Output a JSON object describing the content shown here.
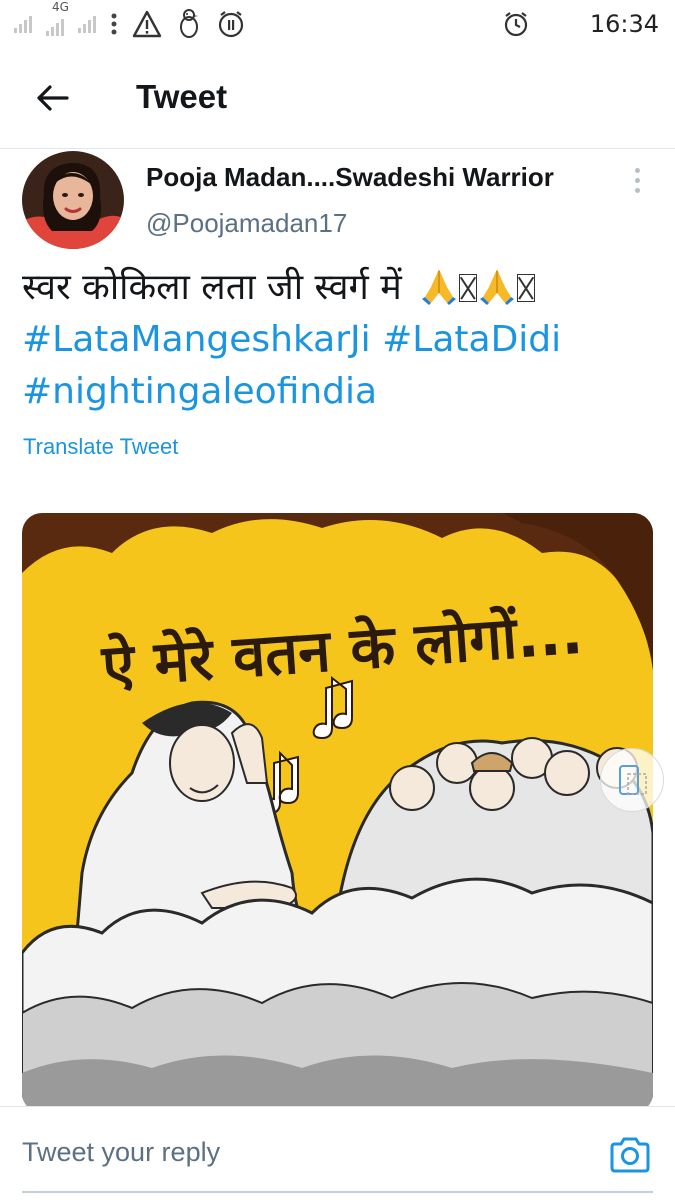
{
  "status_bar": {
    "network": "4G",
    "time": "16:34"
  },
  "header": {
    "title": "Tweet"
  },
  "tweet": {
    "author_name": "Pooja Madan....Swadeshi Warrior",
    "author_handle": "@Poojamadan17",
    "text": "स्वर कोकिला लता जी स्वर्ग में",
    "hashtags": [
      "#LataMangeshkarJi",
      "#LataDidi",
      "#nightingaleofindia"
    ],
    "translate_label": "Translate Tweet",
    "media": {
      "headline": "ऐ मेरे वतन के लोगों..."
    }
  },
  "reply": {
    "placeholder": "Tweet your reply"
  },
  "colors": {
    "accent": "#1b95e0",
    "secondary_text": "#5b7083",
    "media_yellow": "#f5c51c",
    "media_brown": "#5a2a10"
  }
}
